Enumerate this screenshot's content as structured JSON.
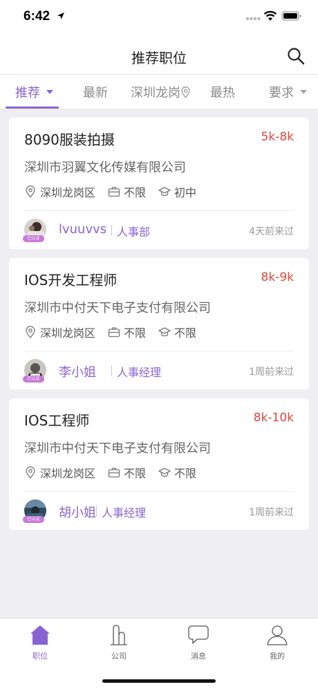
{
  "status": {
    "time": "6:42"
  },
  "nav": {
    "title": "推荐职位"
  },
  "tabs": [
    {
      "label": "推荐",
      "active": true
    },
    {
      "label": "最新"
    },
    {
      "label": "深圳龙岗"
    },
    {
      "label": "最热"
    },
    {
      "label": "要求"
    }
  ],
  "jobs": [
    {
      "title": "8090服装拍摄",
      "salary": "5k-8k",
      "company": "深圳市羽翼文化传媒有限公司",
      "location": "深圳龙岗区",
      "experience": "不限",
      "education": "初中",
      "recruiter": {
        "name": "lvuuvvs",
        "role": "人事部",
        "badge": "已认证"
      },
      "last_seen": "4天前来过"
    },
    {
      "title": "IOS开发工程师",
      "salary": "8k-9k",
      "company": "深圳市中付天下电子支付有限公司",
      "location": "深圳龙岗区",
      "experience": "不限",
      "education": "不限",
      "recruiter": {
        "name": "李小姐",
        "role": "人事经理",
        "badge": "已认证"
      },
      "last_seen": "1周前来过"
    },
    {
      "title": "IOS工程师",
      "salary": "8k-10k",
      "company": "深圳市中付天下电子支付有限公司",
      "location": "深圳龙岗区",
      "experience": "不限",
      "education": "不限",
      "recruiter": {
        "name": "胡小姐",
        "role": "人事经理",
        "badge": "已认证"
      },
      "last_seen": "1周前来过"
    }
  ],
  "tabbar": [
    {
      "label": "职位",
      "icon": "house-icon",
      "active": true
    },
    {
      "label": "公司",
      "icon": "building-icon"
    },
    {
      "label": "消息",
      "icon": "chat-bubble-icon"
    },
    {
      "label": "我的",
      "icon": "person-icon"
    }
  ],
  "colors": {
    "accent": "#8a63d2",
    "salary": "#e0463c",
    "background": "#efeff1"
  }
}
